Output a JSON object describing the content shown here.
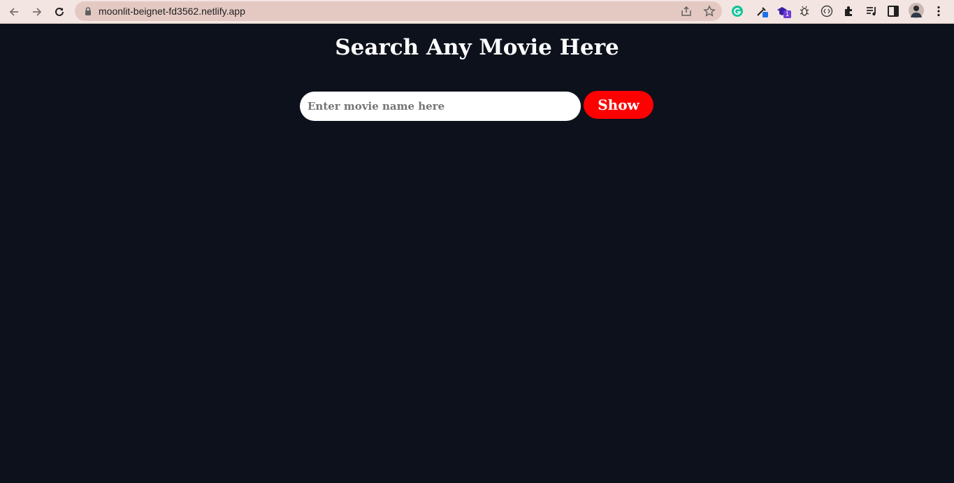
{
  "browser": {
    "url": "moonlit-beignet-fd3562.netlify.app",
    "extension_badges": {
      "badge_a": "1"
    }
  },
  "page": {
    "title": "Search Any Movie Here",
    "search": {
      "placeholder": "Enter movie name here",
      "value": ""
    },
    "show_button_label": "Show"
  },
  "colors": {
    "background": "#0d111c",
    "button": "#ff0000",
    "chrome": "#f3e5e1",
    "omnibox": "#e4c9c3"
  }
}
